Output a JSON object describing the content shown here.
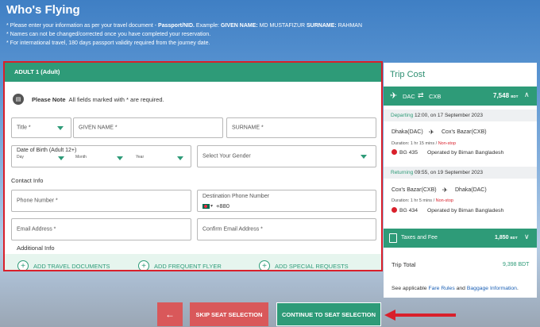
{
  "page": {
    "title": "Who's Flying",
    "notes": [
      {
        "pre": "* Please enter your information as per your travel document - ",
        "bold1": "Passport/NID.",
        "mid1": " Example: ",
        "bold2": "GIVEN NAME:",
        "mid2": " MD MUSTAFIZUR ",
        "bold3": "SURNAME:",
        "post": " RAHMAN"
      },
      "* Names can not be changed/corrected once you have completed your reservation.",
      "* For international travel, 180 days passport validity required from the journey date."
    ]
  },
  "form": {
    "section_title": "ADULT 1 (Adult)",
    "note_bold": "Please Note",
    "note_text": "All fields marked with * are required.",
    "title_placeholder": "Title *",
    "given_name_placeholder": "GIVEN NAME *",
    "surname_placeholder": "SURNAME *",
    "dob_label": "Date of Birth (Adult 12+)",
    "dob_day": "Day",
    "dob_month": "Month",
    "dob_year": "Year",
    "gender_placeholder": "Select Your Gender",
    "contact_info_label": "Contact Info",
    "phone_placeholder": "Phone Number *",
    "dest_phone_label": "Destination Phone Number",
    "dest_phone_code": "+880",
    "email_placeholder": "Email Address *",
    "confirm_email_placeholder": "Confirm Email Address *",
    "additional_info_label": "Additional Info",
    "add_travel_docs": "ADD TRAVEL DOCUMENTS",
    "add_frequent_flyer": "ADD FREQUENT FLYER",
    "add_special_requests": "ADD SPECIAL REQUESTS"
  },
  "trip": {
    "title": "Trip Cost",
    "route_from": "DAC",
    "route_to": "CXB",
    "route_price": "7,548",
    "currency": "BDT",
    "departing_label": "Departing",
    "departing_time": "12:00, on 17 September 2023",
    "dep_from": "Dhaka(DAC)",
    "dep_to": "Cox's Bazar(CXB)",
    "dep_duration": "Duration: 1 hr 15 mins / ",
    "dep_stop": "Non-stop",
    "dep_flight": "BG 435",
    "dep_operator": "Operated by Biman Bangladesh",
    "returning_label": "Returning",
    "returning_time": "09:55, on 19 September 2023",
    "ret_from": "Cox's Bazar(CXB)",
    "ret_to": "Dhaka(DAC)",
    "ret_duration": "Duration: 1 hr 5 mins / ",
    "ret_stop": "Non-stop",
    "ret_flight": "BG 434",
    "ret_operator": "Operated by Biman Bangladesh",
    "taxes_label": "Taxes and Fee",
    "taxes_price": "1,850",
    "total_label": "Trip Total",
    "total_value": "9,398 BDT",
    "fare_prefix": "See applicable ",
    "fare_rules": "Fare Rules",
    "fare_and": " and ",
    "baggage_info": "Baggage Information",
    "fare_suffix": "."
  },
  "actions": {
    "back": "←",
    "skip": "SKIP SEAT SELECTION",
    "continue": "CONTINUE TO SEAT SELECTION"
  },
  "colors": {
    "brand_green": "#2e9b78",
    "highlight_red": "#d9202b",
    "secondary_red": "#d9585a"
  }
}
